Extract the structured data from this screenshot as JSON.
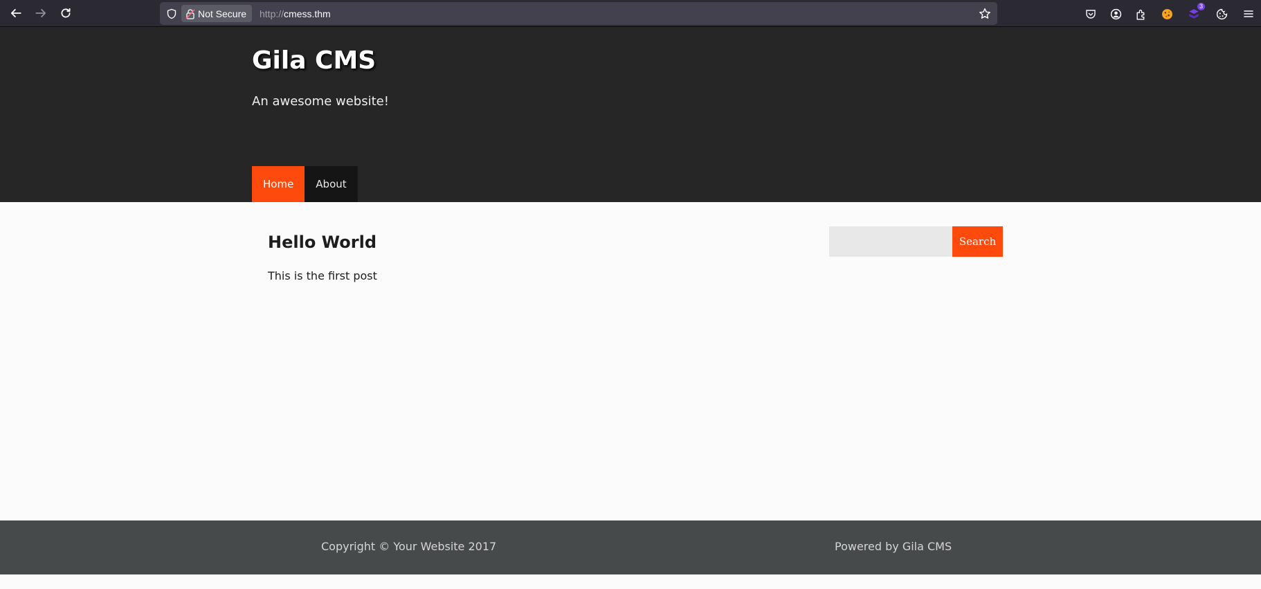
{
  "browser": {
    "security_label": "Not Secure",
    "url_scheme": "http://",
    "url_host": "cmess.thm",
    "extension_badge": "3",
    "icons": [
      "back-icon",
      "forward-icon",
      "reload-icon",
      "shield-icon",
      "lock-warning-icon",
      "star-icon",
      "pocket-icon",
      "account-icon",
      "extensions-icon",
      "cookie-extension-icon",
      "stack-extension-icon",
      "cookie-icon",
      "menu-icon"
    ]
  },
  "site": {
    "title": "Gila CMS",
    "tagline": "An awesome website!",
    "nav": [
      {
        "label": "Home",
        "active": true
      },
      {
        "label": "About",
        "active": false
      }
    ],
    "accent_color": "#ff4a0e",
    "header_color": "#262626"
  },
  "post": {
    "title": "Hello World",
    "body": "This is the first post"
  },
  "search": {
    "placeholder": "",
    "button_label": "Search"
  },
  "footer": {
    "copyright": "Copyright © Your Website 2017",
    "powered": "Powered by Gila CMS"
  }
}
